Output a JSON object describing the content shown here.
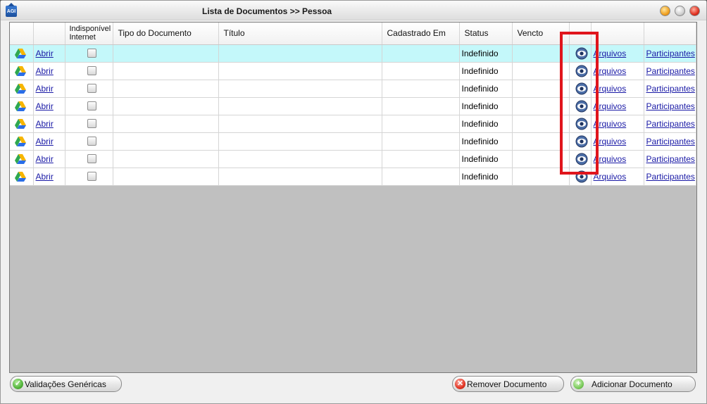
{
  "window": {
    "title": "Lista de Documentos >> Pessoa",
    "app_icon_text": "AGI"
  },
  "grid": {
    "columns": [
      "",
      "",
      "Indisponível Internet",
      "Tipo do Documento",
      "Título",
      "Cadastrado Em",
      "Status",
      "Vencto",
      "",
      "",
      ""
    ],
    "rows": [
      {
        "open": "Abrir",
        "tipo": "",
        "titulo": "",
        "cadastrado": "",
        "status": "Indefinido",
        "vencto": "",
        "arquivos": "Arquivos",
        "participantes": "Participantes"
      },
      {
        "open": "Abrir",
        "tipo": "",
        "titulo": "",
        "cadastrado": "",
        "status": "Indefinido",
        "vencto": "",
        "arquivos": "Arquivos",
        "participantes": "Participantes"
      },
      {
        "open": "Abrir",
        "tipo": "",
        "titulo": "",
        "cadastrado": "",
        "status": "Indefinido",
        "vencto": "",
        "arquivos": "Arquivos",
        "participantes": "Participantes"
      },
      {
        "open": "Abrir",
        "tipo": "",
        "titulo": "",
        "cadastrado": "",
        "status": "Indefinido",
        "vencto": "",
        "arquivos": "Arquivos",
        "participantes": "Participantes"
      },
      {
        "open": "Abrir",
        "tipo": "",
        "titulo": "",
        "cadastrado": "",
        "status": "Indefinido",
        "vencto": "",
        "arquivos": "Arquivos",
        "participantes": "Participantes"
      },
      {
        "open": "Abrir",
        "tipo": "",
        "titulo": "",
        "cadastrado": "",
        "status": "Indefinido",
        "vencto": "",
        "arquivos": "Arquivos",
        "participantes": "Participantes"
      },
      {
        "open": "Abrir",
        "tipo": "",
        "titulo": "",
        "cadastrado": "",
        "status": "Indefinido",
        "vencto": "",
        "arquivos": "Arquivos",
        "participantes": "Participantes"
      },
      {
        "open": "Abrir",
        "tipo": "",
        "titulo": "",
        "cadastrado": "",
        "status": "Indefinido",
        "vencto": "",
        "arquivos": "Arquivos",
        "participantes": "Participantes"
      }
    ]
  },
  "buttons": {
    "validacoes": "Validações Genéricas",
    "remover": "Remover Documento",
    "adicionar": "Adicionar Documento"
  },
  "colors": {
    "selected_row": "#c4f8fa",
    "highlight": "#e0151c",
    "link": "#1a1aa6"
  },
  "icons": {
    "row_file_icon": "drive-icon",
    "row_view_icon": "eye-icon"
  }
}
